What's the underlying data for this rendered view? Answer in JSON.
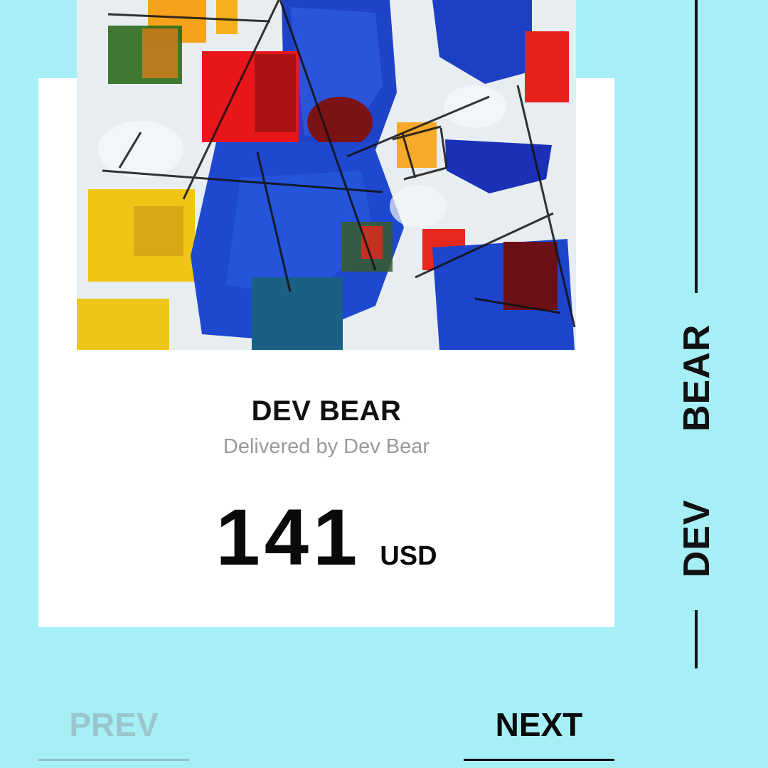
{
  "product": {
    "title": "DEV BEAR",
    "subtitle": "Delivered by Dev Bear",
    "price": "141",
    "currency": "USD",
    "image_icon": "abstract-painting-image"
  },
  "side_label": "DEV BEAR",
  "navigation": {
    "prev_label": "PREV",
    "next_label": "NEXT"
  },
  "colors": {
    "background": "#a6eff7",
    "card": "#ffffff",
    "text": "#0a0a0a",
    "muted_text": "#9a9a9a",
    "disabled_nav": "#9ac5cb"
  }
}
